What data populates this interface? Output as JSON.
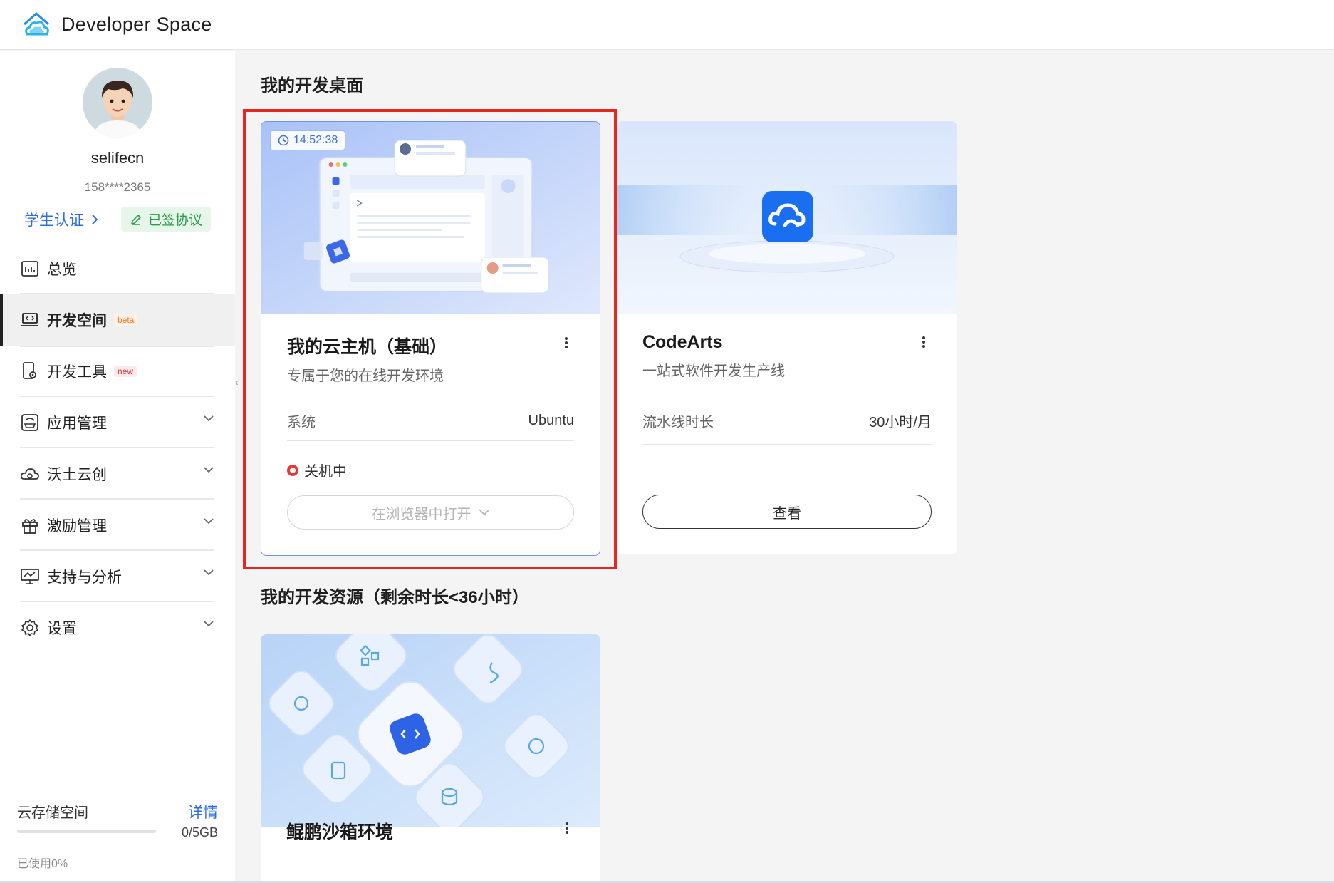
{
  "app": {
    "title": "Developer Space",
    "logo_icon": "house-cloud-logo-icon"
  },
  "profile": {
    "username": "selifecn",
    "phone": "158****2365",
    "student_cert_label": "学生认证",
    "signed_label": "已签协议"
  },
  "sidebar": {
    "items": [
      {
        "label": "总览",
        "icon": "dashboard-icon"
      },
      {
        "label": "开发空间",
        "tag": "beta",
        "icon": "laptop-code-icon"
      },
      {
        "label": "开发工具",
        "tag": "new",
        "icon": "tool-device-icon"
      },
      {
        "label": "应用管理",
        "icon": "app-box-icon"
      },
      {
        "label": "沃土云创",
        "icon": "cloud-icon"
      },
      {
        "label": "激励管理",
        "icon": "gift-icon"
      },
      {
        "label": "支持与分析",
        "icon": "monitor-chart-icon"
      },
      {
        "label": "设置",
        "icon": "gear-icon"
      }
    ],
    "active_index": 1
  },
  "storage": {
    "title": "云存储空间",
    "detail_label": "详情",
    "size": "0/5GB",
    "used_label": "已使用0%",
    "used_fraction": 0
  },
  "main": {
    "desktop_title": "我的开发桌面",
    "resources_title": "我的开发资源（剩余时长<36小时）",
    "cloud_host": {
      "timer": "14:52:38",
      "title": "我的云主机（基础）",
      "desc": "专属于您的在线开发环境",
      "system_key": "系统",
      "system_value": "Ubuntu",
      "status": "关机中",
      "open_btn": "在浏览器中打开"
    },
    "codearts": {
      "title": "CodeArts",
      "desc": "一站式软件开发生产线",
      "pipeline_key": "流水线时长",
      "pipeline_value": "30小时/月",
      "view_btn": "查看"
    },
    "sandbox": {
      "title": "鲲鹏沙箱环境"
    }
  },
  "colors": {
    "accent": "#2f6fdb",
    "highlight": "#e8261e",
    "status_off": "#e53935"
  }
}
